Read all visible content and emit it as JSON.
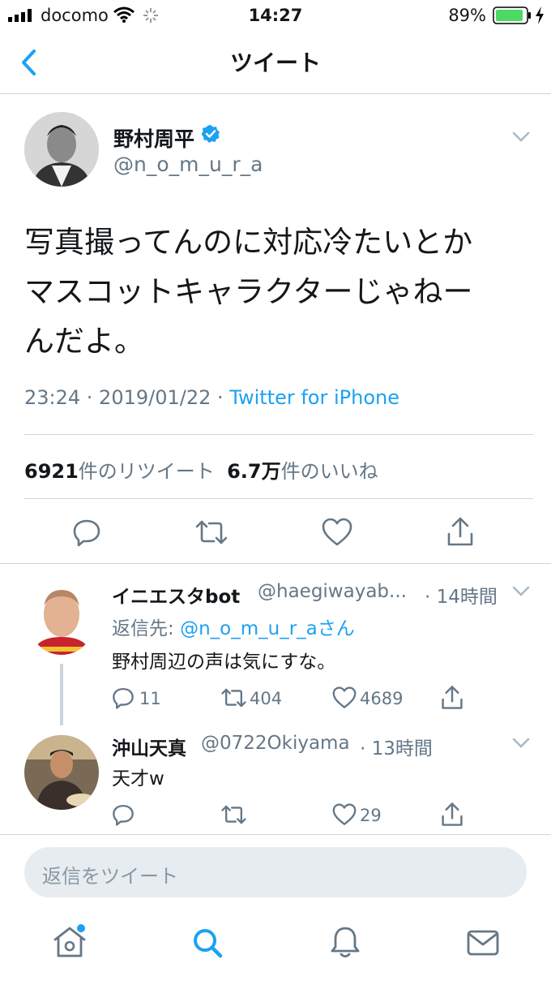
{
  "status_bar": {
    "carrier": "docomo",
    "time": "14:27",
    "battery": "89%"
  },
  "nav": {
    "title": "ツイート"
  },
  "tweet": {
    "name": "野村周平",
    "handle": "@n_o_m_u_r_a",
    "text_lines": [
      "写真撮ってんのに対応冷たいとか",
      "マスコットキャラクターじゃねー",
      "んだよ。"
    ],
    "timestamp": "23:24 · 2019/01/22 · ",
    "source": "Twitter for iPhone",
    "retweet_count": "6921",
    "retweet_label": "件のリツイート",
    "like_count": "6.7万",
    "like_label": "件のいいね"
  },
  "replies": [
    {
      "name": "イニエスタbot",
      "handle": "@haegiwayab...",
      "time": "· 14時間",
      "reply_to_prefix": "返信先: ",
      "reply_to": "@n_o_m_u_r_aさん",
      "text": "野村周辺の声は気にすな。",
      "reply_count": "11",
      "retweet_count": "404",
      "like_count": "4689"
    },
    {
      "name": "沖山天真",
      "handle": "@0722Okiyama",
      "time": "· 13時間",
      "text": "天才w",
      "like_count": "29"
    }
  ],
  "composer": {
    "placeholder": "返信をツイート"
  },
  "colors": {
    "accent": "#1da1f2",
    "battery": "#4cd964",
    "secondary_text": "#657786",
    "icon_gray": "#657786"
  },
  "icons": [
    "back-chevron-icon",
    "verified-badge-icon",
    "chevron-down-icon",
    "reply-icon",
    "retweet-icon",
    "like-icon",
    "share-icon",
    "home-icon",
    "search-icon",
    "notifications-icon",
    "messages-icon"
  ]
}
